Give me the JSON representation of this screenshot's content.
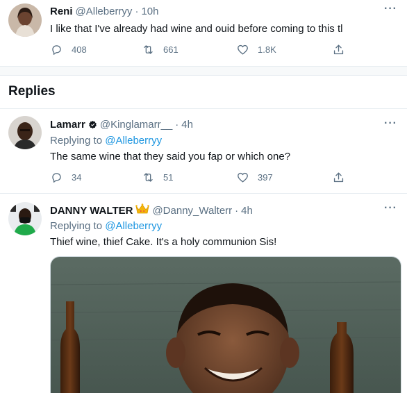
{
  "main_tweet": {
    "name": "Reni",
    "handle": "@Alleberryy",
    "time": "10h",
    "text": "I like that I've already had wine and ouid before coming to this tl",
    "replies": "408",
    "retweets": "661",
    "likes": "1.8K"
  },
  "section_title": "Replies",
  "replies": [
    {
      "name": "Lamarr",
      "handle": "@Kinglamarr__",
      "time": "4h",
      "replying_prefix": "Replying to",
      "replying_to": "@Alleberryy",
      "text": "The same wine that they said you fap or which one?",
      "replies": "34",
      "retweets": "51",
      "likes": "397"
    },
    {
      "name": "DANNY WALTER",
      "handle": "@Danny_Walterr",
      "time": "4h",
      "replying_prefix": "Replying to",
      "replying_to": "@Alleberryy",
      "text": "Thief wine, thief Cake. It's a holy communion Sis!"
    }
  ],
  "icons": {
    "reply": "reply-icon",
    "retweet": "retweet-icon",
    "like": "heart-icon",
    "share": "share-icon",
    "more": "more-icon",
    "verified": "verified-badge-icon",
    "crown": "crown-emoji"
  },
  "colors": {
    "link": "#1b95e0",
    "secondary_text": "#5b7083",
    "divider": "#e6ecf0"
  }
}
